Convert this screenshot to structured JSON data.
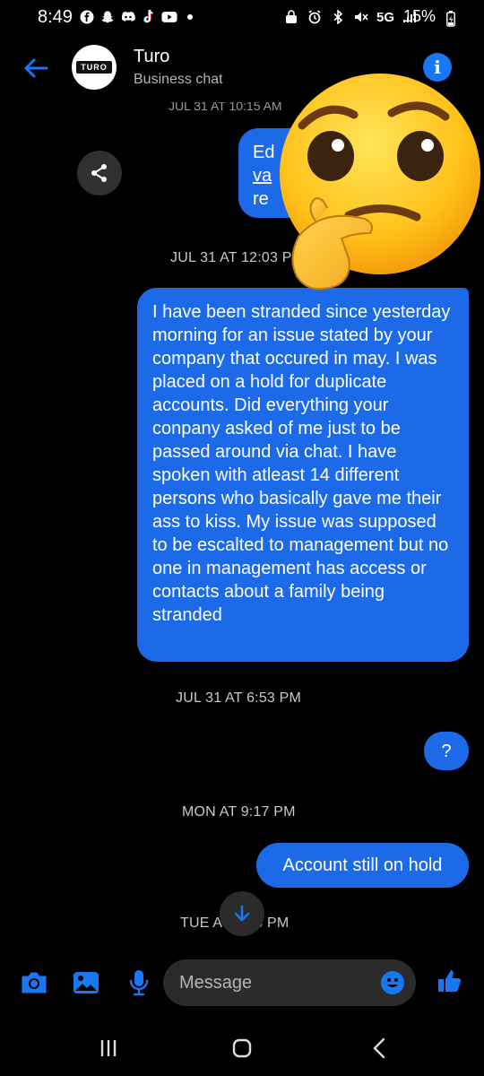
{
  "status_bar": {
    "time": "8:49",
    "network": "5G",
    "battery": "15%"
  },
  "header": {
    "title": "Turo",
    "subtitle": "Business chat",
    "avatar_logo_text": "TURO"
  },
  "messages": {
    "partial_timestamp": "JUL 31 AT 10:15 AM",
    "bubble1_lines": [
      "Ed",
      "va",
      "re"
    ],
    "ts1": "JUL 31 AT 12:03 PM",
    "bubble2": "I have been stranded since yesterday morning for an issue stated by your company that occured in may. I was placed on a hold for duplicate accounts. Did everything your conpany asked of me just to be passed around via chat. I have spoken with atleast 14 different persons who basically gave me their ass to kiss. My issue was supposed to be escalted to management but no one in management has access or contacts about a family being stranded",
    "ts2": "JUL 31 AT 6:53 PM",
    "bubble3": "?",
    "ts3": "MON AT 9:17 PM",
    "bubble4": "Account still on hold",
    "ts4": "TUE AT 3:03 PM"
  },
  "composer": {
    "placeholder": "Message"
  },
  "icons": {
    "back": "back-arrow-icon",
    "info": "info-icon",
    "share": "share-icon",
    "camera": "camera-icon",
    "gallery": "gallery-icon",
    "mic": "microphone-icon",
    "emoji": "smiley-icon",
    "like": "thumbs-up-icon",
    "scroll": "arrow-down-icon"
  },
  "colors": {
    "accent": "#1877f2",
    "bubble": "#1c6ae8",
    "background": "#000000"
  }
}
